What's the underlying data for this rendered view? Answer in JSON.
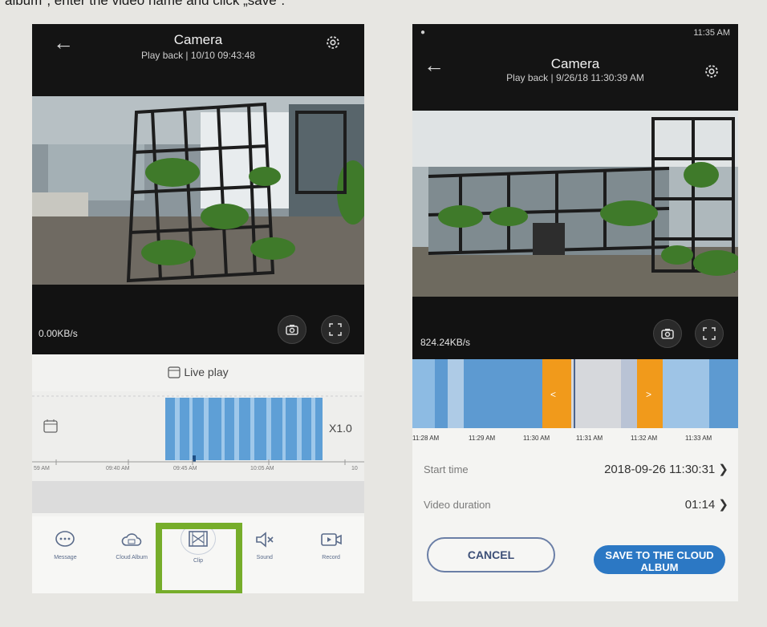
{
  "caption": {
    "text": "album\", enter the video name and click „save“."
  },
  "left_phone": {
    "title": "Camera",
    "subtitle": "Play back | 10/10 09:43:48",
    "speed": "0.00KB/s",
    "live_play": "Live play",
    "zoom": "X1.0",
    "ticks": [
      "59 AM",
      "09:40 AM",
      "09:45 AM",
      "10:05 AM",
      "10"
    ],
    "nav": [
      {
        "label": "Message",
        "icon": "message-icon"
      },
      {
        "label": "Cloud Album",
        "icon": "cloud-album-icon"
      },
      {
        "label": "Clip",
        "icon": "clip-icon"
      },
      {
        "label": "Sound",
        "icon": "sound-icon"
      },
      {
        "label": "Record",
        "icon": "record-icon"
      }
    ],
    "highlight_color": "#76ad2a"
  },
  "right_phone": {
    "status_time": "11:35 AM",
    "title": "Camera",
    "subtitle": "Play back | 9/26/18 11:30:39 AM",
    "speed": "824.24KB/s",
    "time_labels": [
      "11:28 AM",
      "11:29 AM",
      "11:30 AM",
      "11:31 AM",
      "11:32 AM",
      "11:33 AM"
    ],
    "start_time_label": "Start time",
    "start_time_value": "2018-09-26 11:30:31",
    "duration_label": "Video duration",
    "duration_value": "01:14",
    "cancel_label": "CANCEL",
    "save_label": "SAVE TO THE CLOUD ALBUM",
    "accent": "#2c78c4",
    "marker_color": "#f19a1b"
  }
}
